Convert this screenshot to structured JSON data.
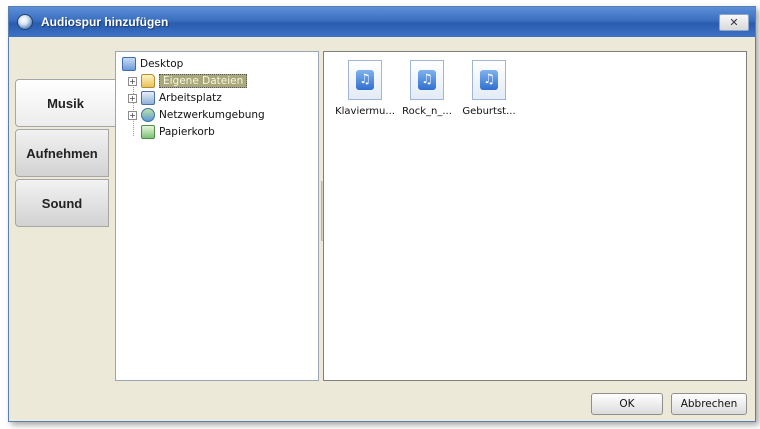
{
  "window": {
    "title": "Audiospur hinzufügen",
    "close_label": "✕"
  },
  "tabs": [
    {
      "label": "Musik",
      "active": true
    },
    {
      "label": "Aufnehmen",
      "active": false
    },
    {
      "label": "Sound",
      "active": false
    }
  ],
  "tree": {
    "root": {
      "label": "Desktop",
      "icon": "desktop-icon"
    },
    "items": [
      {
        "label": "Eigene Dateien",
        "icon": "folder-icon",
        "expander": "+",
        "selected": true
      },
      {
        "label": "Arbeitsplatz",
        "icon": "computer-icon",
        "expander": "+",
        "selected": false
      },
      {
        "label": "Netzwerkumgebung",
        "icon": "network-icon",
        "expander": "+",
        "selected": false
      },
      {
        "label": "Papierkorb",
        "icon": "recycle-bin-icon",
        "expander": "",
        "selected": false
      }
    ]
  },
  "files": [
    {
      "label": "Klaviermu...",
      "icon": "audio-file-icon",
      "glyph": "♫"
    },
    {
      "label": "Rock_n_...",
      "icon": "audio-file-icon",
      "glyph": "♫"
    },
    {
      "label": "Geburtst...",
      "icon": "audio-file-icon",
      "glyph": "♫"
    }
  ],
  "buttons": {
    "ok": "OK",
    "cancel": "Abbrechen"
  },
  "colors": {
    "title_bar": "#3a6fc0",
    "dialog_bg": "#ece9d8",
    "selected_item": "#a9a878"
  }
}
